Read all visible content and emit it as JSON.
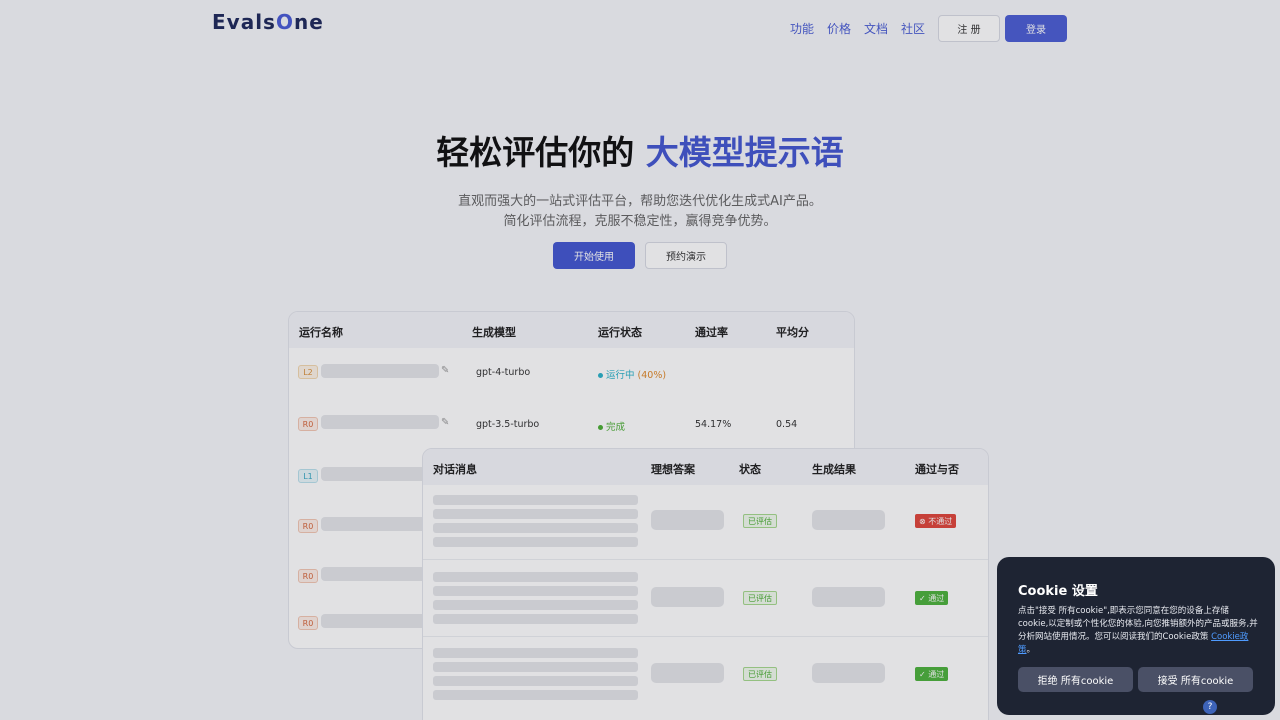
{
  "header": {
    "logo_prefix": "Evals",
    "logo_o": "O",
    "logo_suffix": "ne",
    "nav": [
      "功能",
      "价格",
      "文档",
      "社区"
    ],
    "register": "注 册",
    "login": "登录"
  },
  "hero": {
    "title_main": "轻松评估你的 ",
    "title_accent": "大模型提示语",
    "subtitle_line1": "直观而强大的一站式评估平台，帮助您迭代优化生成式AI产品。",
    "subtitle_line2": "简化评估流程，克服不稳定性，赢得竞争优势。",
    "start_btn": "开始使用",
    "demo_btn": "预约演示"
  },
  "runs_table": {
    "headers": [
      "运行名称",
      "生成模型",
      "运行状态",
      "通过率",
      "平均分"
    ],
    "rows": [
      {
        "tag": "L2",
        "model": "gpt-4-turbo",
        "status": "运行中",
        "progress": "(40%)",
        "pass_rate": "",
        "avg": ""
      },
      {
        "tag": "R0",
        "model": "gpt-3.5-turbo",
        "status": "完成",
        "progress": "",
        "pass_rate": "54.17%",
        "avg": "0.54"
      },
      {
        "tag": "L1"
      },
      {
        "tag": "R0"
      },
      {
        "tag": "R0"
      },
      {
        "tag": "R0"
      }
    ]
  },
  "detail_table": {
    "headers": [
      "对话消息",
      "理想答案",
      "状态",
      "生成结果",
      "通过与否"
    ],
    "rows": [
      {
        "status": "已评估",
        "result": "不通过"
      },
      {
        "status": "已评估",
        "result": "通过"
      },
      {
        "status": "已评估",
        "result": "通过"
      }
    ]
  },
  "cookie": {
    "title": "Cookie 设置",
    "text": "点击\"接受 所有cookie\",即表示您同意在您的设备上存储cookie,以定制或个性化您的体验,向您推销额外的产品或服务,并分析网站使用情况。您可以阅读我们的Cookie政策",
    "link": "Cookie政策",
    "text_end": "。",
    "reject": "拒绝 所有cookie",
    "accept": "接受 所有cookie"
  }
}
